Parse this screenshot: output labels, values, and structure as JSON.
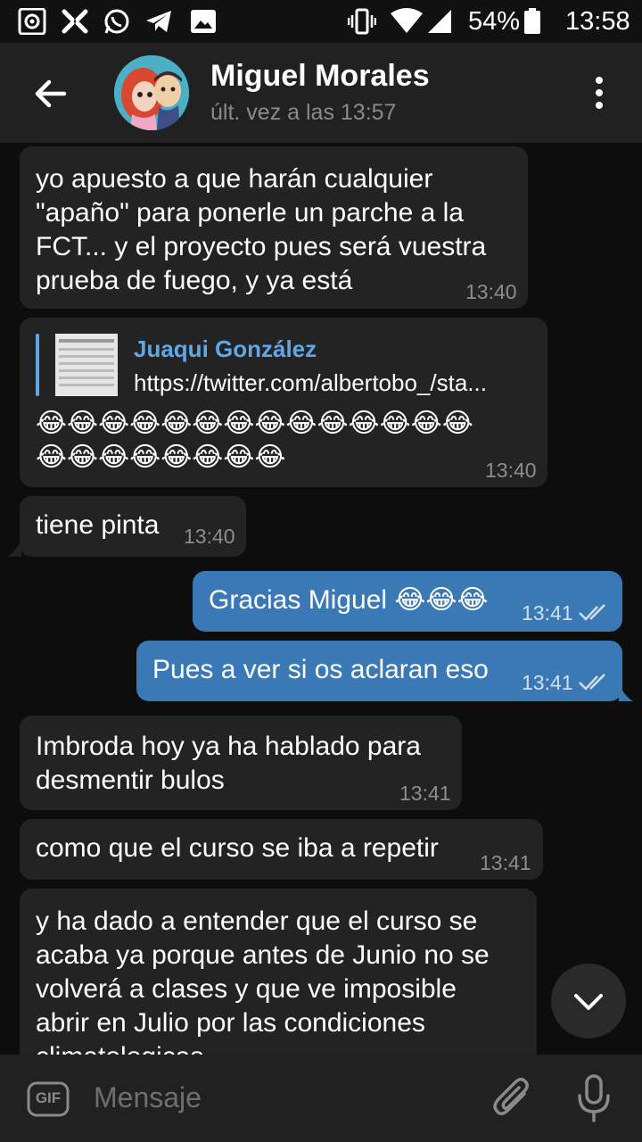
{
  "status_bar": {
    "battery": "54%",
    "time": "13:58"
  },
  "header": {
    "contact_name": "Miguel Morales",
    "last_seen": "últ. vez a las 13:57"
  },
  "messages": [
    {
      "lines": [
        "yo apuesto a que harán cualquier",
        "\"apaño\" para ponerle un parche a la",
        "FCT... y el proyecto pues será vuestra",
        "prueba de fuego, y ya está"
      ],
      "time": "13:40"
    },
    {
      "reply_name": "Juaqui González",
      "reply_text": "https://twitter.com/albertobo_/sta...",
      "emoji_line1": "😂😂😂😂😂😂😂😂😂😂😂😂😂😂",
      "emoji_line2": "😂😂😂😂😂😂😂😂",
      "time": "13:40"
    },
    {
      "text": "tiene pinta",
      "time": "13:40"
    },
    {
      "text": "Gracias Miguel 😂😂😂",
      "time": "13:41"
    },
    {
      "text": "Pues a ver si os aclaran eso",
      "time": "13:41"
    },
    {
      "lines": [
        "Imbroda hoy ya ha hablado para",
        "desmentir bulos"
      ],
      "time": "13:41"
    },
    {
      "text": "como que el curso se iba a repetir",
      "time": "13:41"
    },
    {
      "lines": [
        "y ha dado a entender que el curso se",
        "acaba ya porque antes de Junio no se",
        "volverá a clases y que ve imposible",
        "abrir en Julio por las condiciones",
        "climatologicas..."
      ]
    }
  ],
  "composer": {
    "gif_label": "GIF",
    "placeholder": "Mensaje"
  },
  "colors": {
    "incoming_bubble": "#232323",
    "outgoing_bubble": "#3a79b5",
    "accent": "#61a6e6"
  }
}
